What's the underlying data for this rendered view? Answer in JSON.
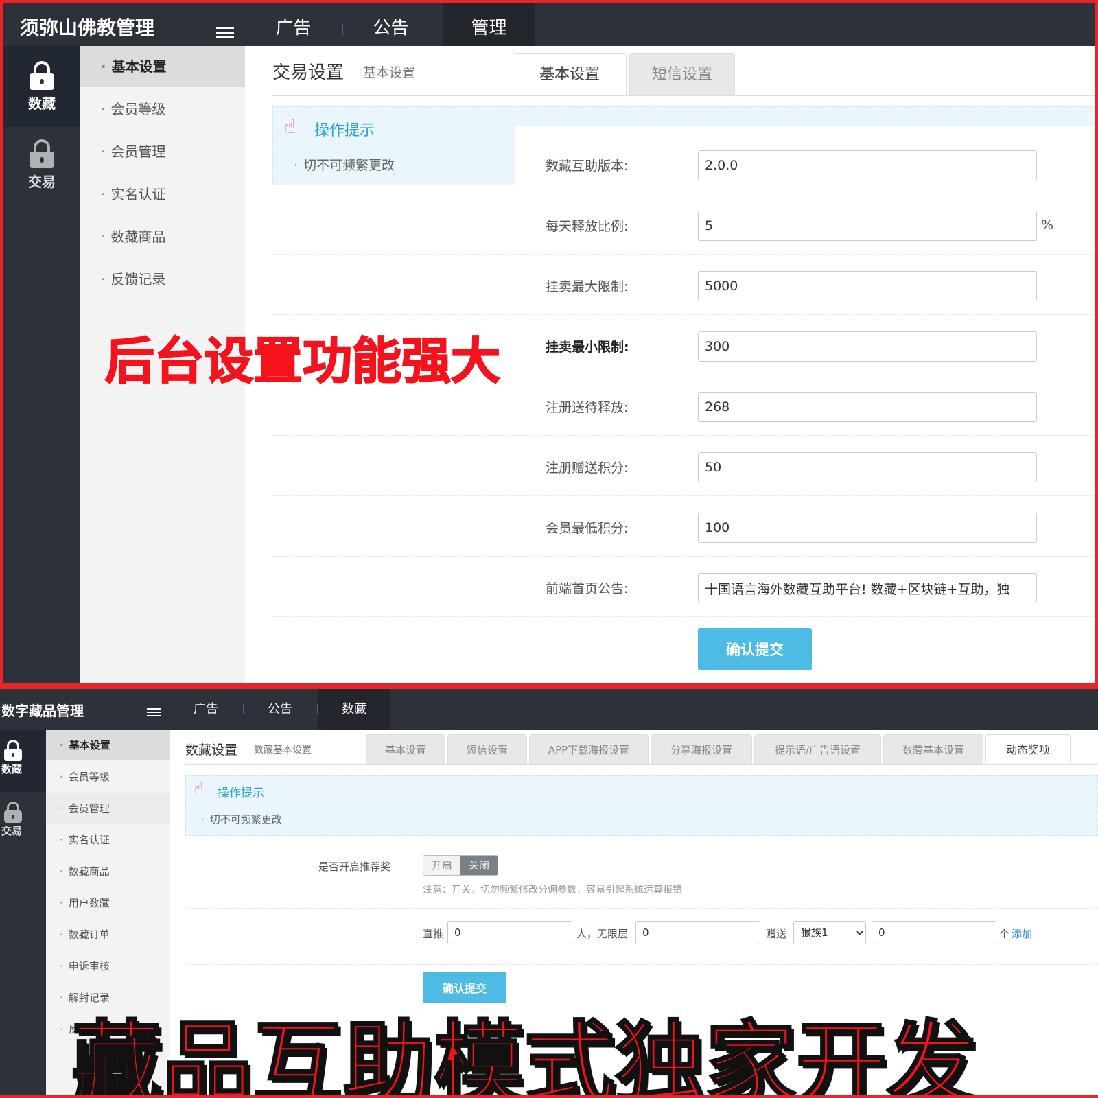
{
  "top": {
    "brand": "须弥山佛教管理",
    "nav": [
      "广告",
      "公告",
      "管理"
    ],
    "left_tabs": [
      "数藏",
      "交易"
    ],
    "submenu": [
      "基本设置",
      "会员等级",
      "会员管理",
      "实名认证",
      "数藏商品",
      "反馈记录"
    ],
    "page_title": "交易设置",
    "page_sub": "基本设置",
    "tabs": [
      "基本设置",
      "短信设置"
    ],
    "tip_title": "操作提示",
    "tip_text": "切不可频繁更改",
    "fields": [
      {
        "label": "数藏互助版本:",
        "value": "2.0.0"
      },
      {
        "label": "每天释放比例:",
        "value": "5",
        "suffix": "%"
      },
      {
        "label": "挂卖最大限制:",
        "value": "5000"
      },
      {
        "label": "挂卖最小限制:",
        "value": "300"
      },
      {
        "label": "注册送待释放:",
        "value": "268"
      },
      {
        "label": "注册赠送积分:",
        "value": "50"
      },
      {
        "label": "会员最低积分:",
        "value": "100"
      },
      {
        "label": "前端首页公告:",
        "value": "十国语言海外数藏互助平台! 数藏+区块链+互助，独"
      }
    ],
    "submit": "确认提交",
    "banner": "后台设置功能强大"
  },
  "bottom": {
    "brand": "数字藏品管理",
    "nav": [
      "广告",
      "公告",
      "数藏"
    ],
    "left_tabs": [
      "数藏",
      "交易"
    ],
    "submenu": [
      "基本设置",
      "会员等级",
      "会员管理",
      "实名认证",
      "数藏商品",
      "用户数藏",
      "数藏订单",
      "申诉审核",
      "解封记录",
      "反"
    ],
    "page_title": "数藏设置",
    "page_sub": "数藏基本设置",
    "tabs": [
      "基本设置",
      "短信设置",
      "APP下载海报设置",
      "分享海报设置",
      "提示语/广告语设置",
      "数藏基本设置",
      "动态奖项"
    ],
    "tip_title": "操作提示",
    "tip_text": "切不可频繁更改",
    "toggle_label": "是否开启推荐奖",
    "toggle_on": "开启",
    "toggle_off": "关闭",
    "toggle_note": "注意：开关，切勿频繁修改分佣参数，容易引起系统运算报错",
    "rule_direct": "直推",
    "rule_direct_value": "0",
    "rule_people": "人，无限层",
    "rule_layer_value": "0",
    "rule_give": "赠送",
    "rule_select": "猴族1",
    "rule_amount_value": "0",
    "rule_unit": "个",
    "rule_add": "添加",
    "submit": "确认提交",
    "banner": "藏品互助模式独家开发"
  }
}
